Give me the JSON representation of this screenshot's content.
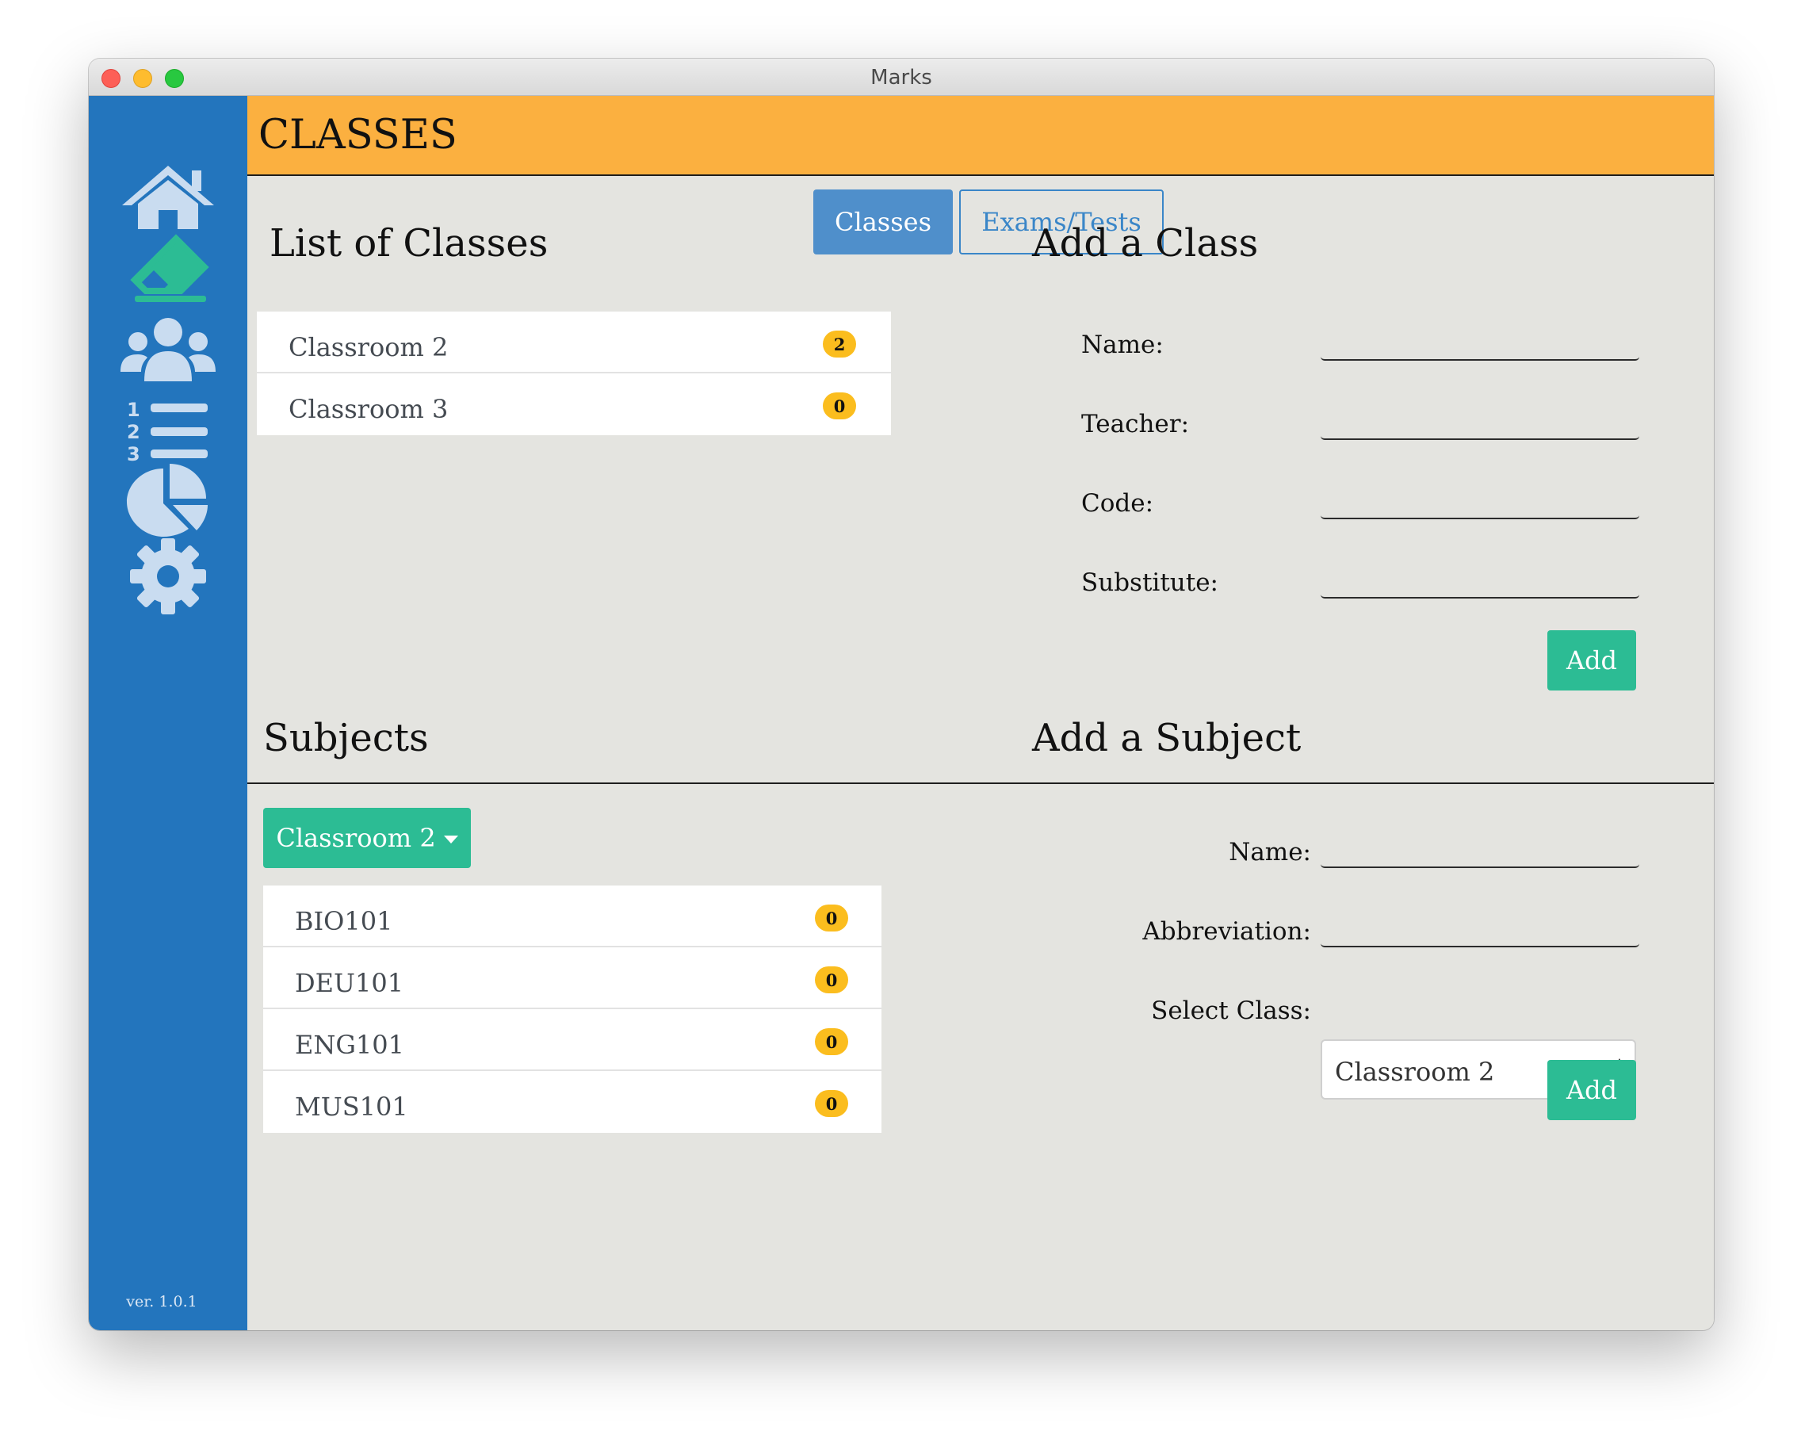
{
  "window": {
    "title": "Marks"
  },
  "sidebar": {
    "items": [
      {
        "icon": "home-icon"
      },
      {
        "icon": "eraser-icon"
      },
      {
        "icon": "users-icon"
      },
      {
        "icon": "numbered-list-icon"
      },
      {
        "icon": "pie-chart-icon"
      },
      {
        "icon": "gear-icon"
      }
    ],
    "version": "ver. 1.0.1"
  },
  "header": {
    "title": "CLASSES"
  },
  "tabs": [
    {
      "label": "Classes",
      "active": true
    },
    {
      "label": "Exams/Tests",
      "active": false
    }
  ],
  "classes_list": {
    "title": "List of Classes",
    "items": [
      {
        "label": "Classroom 2",
        "count": "2"
      },
      {
        "label": "Classroom 3",
        "count": "0"
      }
    ]
  },
  "add_class": {
    "title": "Add a Class",
    "fields": [
      {
        "label": "Name:",
        "value": ""
      },
      {
        "label": "Teacher:",
        "value": ""
      },
      {
        "label": "Code:",
        "value": ""
      },
      {
        "label": "Substitute:",
        "value": ""
      }
    ],
    "add_label": "Add"
  },
  "subjects": {
    "title": "Subjects",
    "dropdown_label": "Classroom 2",
    "items": [
      {
        "label": "BIO101",
        "count": "0"
      },
      {
        "label": "DEU101",
        "count": "0"
      },
      {
        "label": "ENG101",
        "count": "0"
      },
      {
        "label": "MUS101",
        "count": "0"
      }
    ]
  },
  "add_subject": {
    "title": "Add a Subject",
    "name_label": "Name:",
    "abbreviation_label": "Abbreviation:",
    "select_label": "Select Class:",
    "select_value": "Classroom 2",
    "add_label": "Add"
  },
  "colors": {
    "sidebar": "#2375bd",
    "header": "#fbb040",
    "accent_green": "#2cbc94",
    "tab_active": "#4f8fcb",
    "badge": "#fbbd1e",
    "icon_light": "#c9dcf0",
    "icon_teal": "#2cbc94"
  }
}
